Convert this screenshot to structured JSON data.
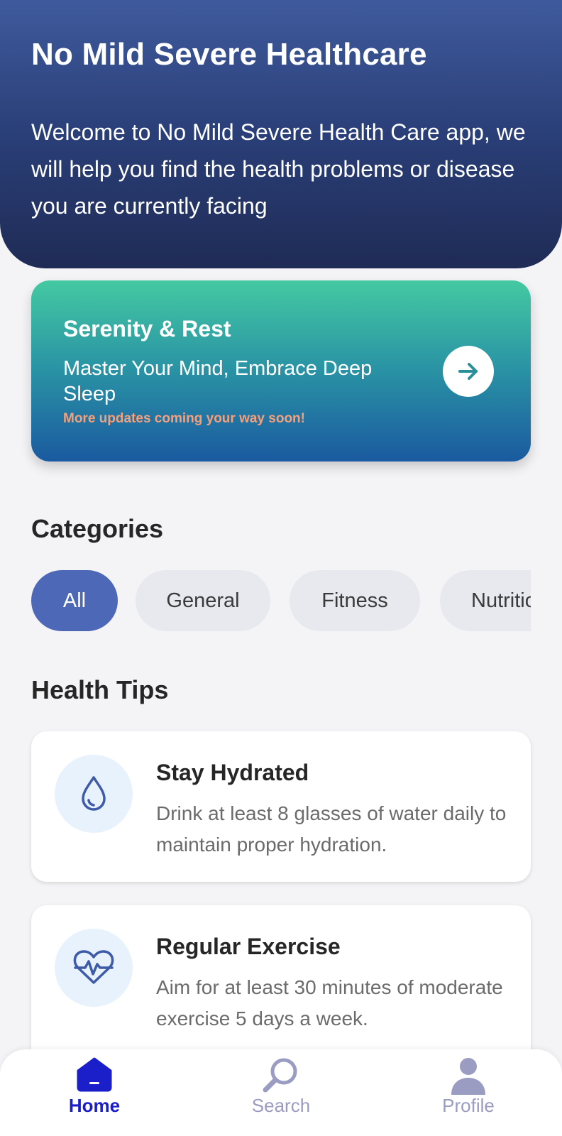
{
  "header": {
    "title": "No Mild Severe Healthcare",
    "welcome": "Welcome to No Mild Severe Health Care app, we will help you find the health problems or disease you are currently facing"
  },
  "banner": {
    "title": "Serenity & Rest",
    "subtitle": "Master Your Mind, Embrace Deep Sleep",
    "note": "More updates coming your way soon!",
    "button_icon": "arrow-right-icon"
  },
  "categories": {
    "title": "Categories",
    "items": [
      {
        "label": "All",
        "selected": true
      },
      {
        "label": "General",
        "selected": false
      },
      {
        "label": "Fitness",
        "selected": false
      },
      {
        "label": "Nutrition",
        "selected": false
      }
    ]
  },
  "tips": {
    "title": "Health Tips",
    "items": [
      {
        "title": "Stay Hydrated",
        "text": "Drink at least 8 glasses of water daily to maintain proper hydration.",
        "icon": "water-drop-icon"
      },
      {
        "title": "Regular Exercise",
        "text": "Aim for at least 30 minutes of moderate exercise 5 days a week.",
        "icon": "heartbeat-icon"
      }
    ]
  },
  "nav": {
    "items": [
      {
        "label": "Home",
        "icon": "home-icon",
        "active": true
      },
      {
        "label": "Search",
        "icon": "search-icon",
        "active": false
      },
      {
        "label": "Profile",
        "icon": "profile-icon",
        "active": false
      }
    ]
  },
  "colors": {
    "header_top": "#3f5a9c",
    "header_bottom": "#1f2b55",
    "chip_active": "#4d68b7",
    "nav_active": "#1b1fc9",
    "nav_inactive": "#9a9cc2",
    "banner_note": "#f5a07c"
  }
}
